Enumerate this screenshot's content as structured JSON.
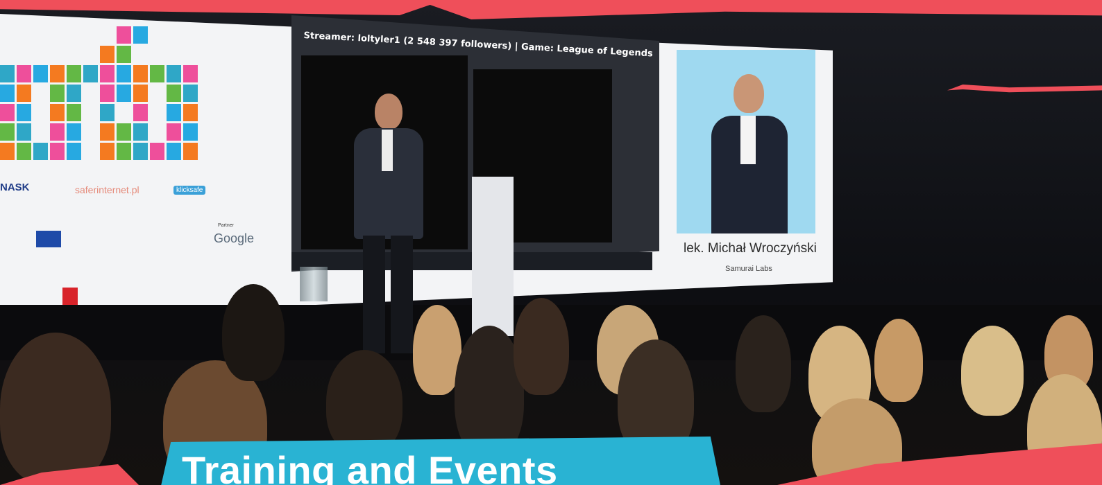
{
  "screen": {
    "stream_header": "Streamer: loltyler1 (2 548 397 followers) | Game: League of Legends",
    "speaker_name": "lek. Michał Wroczyński",
    "speaker_org": "Samurai Labs",
    "sponsors": {
      "nask": "NASK",
      "saferinternet": "saferinternet.pl",
      "clicksafe": "klicksafe",
      "partner_label": "Partner",
      "google": "Google"
    }
  },
  "banner": {
    "title": "Training and Events"
  },
  "colors": {
    "brand_red": "#ef4f5a",
    "banner_blue": "#29b3d3"
  }
}
